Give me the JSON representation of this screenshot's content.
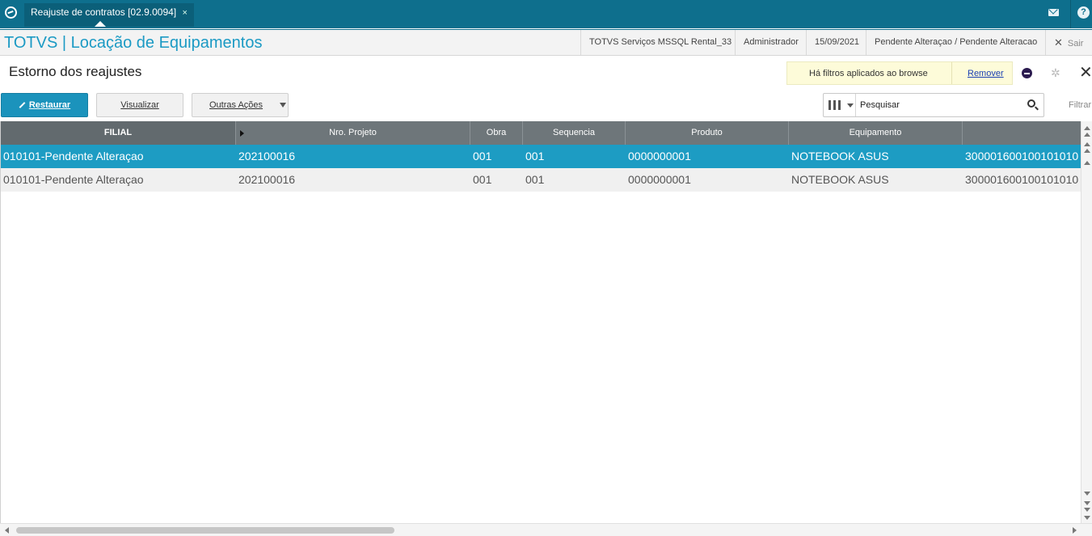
{
  "topbar": {
    "tab_label": "Reajuste de contratos [02.9.0094]",
    "tab_close": "×",
    "help_glyph": "?"
  },
  "product": {
    "title": "TOTVS | Locação de Equipamentos",
    "environment": "TOTVS Serviços MSSQL Rental_33",
    "user": "Administrador",
    "date": "15/09/2021",
    "branch": "Pendente Alteraçao / Pendente Alteracao",
    "exit_label": "Sair"
  },
  "page": {
    "title": "Estorno dos reajustes",
    "filter_notice": "Há filtros aplicados ao browse",
    "filter_remove": "Remover"
  },
  "toolbar": {
    "restore_label": "Restaurar",
    "view_label": "Visualizar",
    "other_actions_label": "Outras Ações"
  },
  "search": {
    "placeholder": "Pesquisar",
    "filter_label": "Filtrar"
  },
  "grid": {
    "columns": [
      "FILIAL",
      "Nro. Projeto",
      "Obra",
      "Sequencia",
      "Produto",
      "Equipamento",
      ""
    ],
    "rows": [
      [
        "010101-Pendente Alteraçao",
        "202100016",
        "001",
        "001",
        "0000000001",
        "NOTEBOOK ASUS",
        "300001600100101010"
      ],
      [
        "010101-Pendente Alteraçao",
        "202100016",
        "001",
        "001",
        "0000000001",
        "NOTEBOOK ASUS",
        "300001600100101010"
      ]
    ],
    "selected_row": 0
  },
  "colors": {
    "topbar": "#0e6f8d",
    "accent": "#1b93bc",
    "selected_row": "#1d9cc3",
    "header": "#6e767a"
  }
}
